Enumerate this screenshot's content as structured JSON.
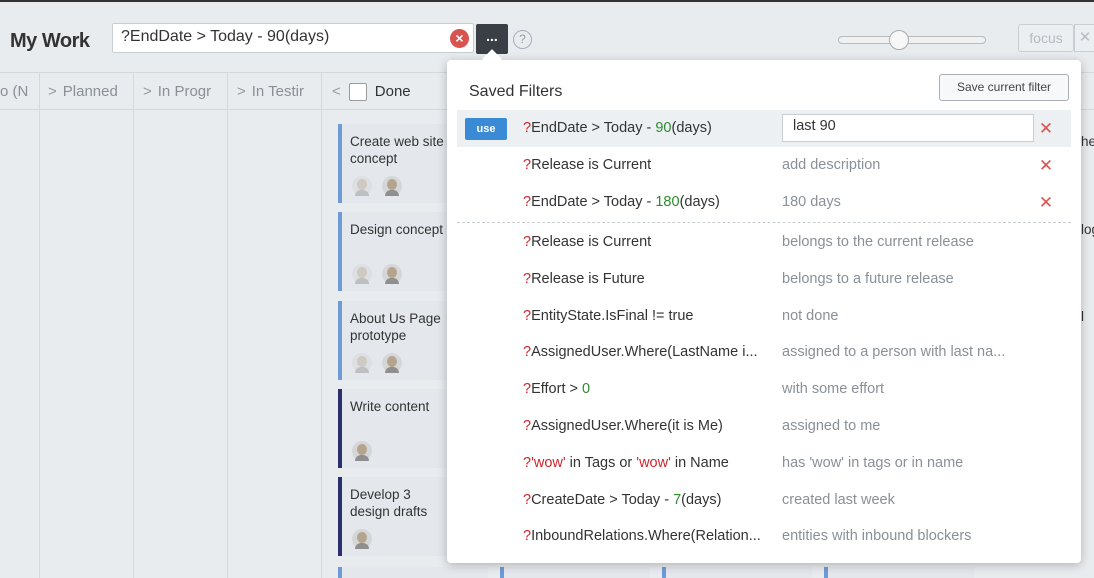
{
  "header": {
    "title": "My Work",
    "filter_value": "?EndDate > Today - 90(days)",
    "menu_label": "...",
    "help_label": "?",
    "focus_label": "focus",
    "close_label": "✕",
    "slider_level": 0.4
  },
  "columns": [
    {
      "label": "o (N",
      "chevron": ""
    },
    {
      "label": "Planned",
      "chevron": ">"
    },
    {
      "label": "In Progr",
      "chevron": ">"
    },
    {
      "label": "In Testir",
      "chevron": ">"
    },
    {
      "label": "Done",
      "chevron": "<"
    }
  ],
  "cards": [
    {
      "title": "Create web site concept",
      "avatars": 2
    },
    {
      "title": "Design concept",
      "avatars": 2
    },
    {
      "title": "About Us Page prototype",
      "avatars": 2
    },
    {
      "title": "Write content",
      "avatars": 1
    },
    {
      "title": "Develop 3 design drafts",
      "avatars": 1
    }
  ],
  "right_fragments": [
    "he",
    "log",
    "l"
  ],
  "saved_filters": {
    "title": "Saved Filters",
    "save_button": "Save current filter",
    "use_label": "use",
    "custom": [
      {
        "parts": [
          [
            "q",
            "?"
          ],
          [
            "t",
            "EndDate > Today - "
          ],
          [
            "n",
            "90"
          ],
          [
            "t",
            "(days)"
          ]
        ],
        "description": "last 90",
        "editing": true,
        "active": true
      },
      {
        "parts": [
          [
            "q",
            "?"
          ],
          [
            "t",
            "Release is Current"
          ]
        ],
        "description": "add description",
        "editing": false,
        "active": false
      },
      {
        "parts": [
          [
            "q",
            "?"
          ],
          [
            "t",
            "EndDate > Today - "
          ],
          [
            "n",
            "180"
          ],
          [
            "t",
            "(days)"
          ]
        ],
        "description": "180 days",
        "editing": false,
        "active": false
      }
    ],
    "predefined": [
      {
        "parts": [
          [
            "q",
            "?"
          ],
          [
            "t",
            "Release is Current"
          ]
        ],
        "description": "belongs to the current release"
      },
      {
        "parts": [
          [
            "q",
            "?"
          ],
          [
            "t",
            "Release is Future"
          ]
        ],
        "description": "belongs to a future release"
      },
      {
        "parts": [
          [
            "q",
            "?"
          ],
          [
            "t",
            "EntityState.IsFinal != true"
          ]
        ],
        "description": "not done"
      },
      {
        "parts": [
          [
            "q",
            "?"
          ],
          [
            "t",
            "AssignedUser.Where(LastName i..."
          ]
        ],
        "description": "assigned to a person with last na..."
      },
      {
        "parts": [
          [
            "q",
            "?"
          ],
          [
            "t",
            "Effort > "
          ],
          [
            "n",
            "0"
          ]
        ],
        "description": "with some effort"
      },
      {
        "parts": [
          [
            "q",
            "?"
          ],
          [
            "t",
            "AssignedUser.Where(it is Me)"
          ]
        ],
        "description": "assigned to me"
      },
      {
        "parts": [
          [
            "q",
            "?"
          ],
          [
            "s",
            "'wow'"
          ],
          [
            "t",
            " in Tags or "
          ],
          [
            "s",
            "'wow'"
          ],
          [
            "t",
            " in Name"
          ]
        ],
        "description": "has 'wow' in tags or in name"
      },
      {
        "parts": [
          [
            "q",
            "?"
          ],
          [
            "t",
            "CreateDate > Today - "
          ],
          [
            "n",
            "7"
          ],
          [
            "t",
            "(days)"
          ]
        ],
        "description": "created last week"
      },
      {
        "parts": [
          [
            "q",
            "?"
          ],
          [
            "t",
            "InboundRelations.Where(Relation..."
          ]
        ],
        "description": "entities with inbound blockers"
      }
    ]
  },
  "colors": {
    "accent": "#3a8ad6",
    "delete": "#d9534f",
    "keyword": "#d0242b",
    "number": "#2e8b2e",
    "card_border": "#6e9bd6",
    "card_border_dark": "#2b2f6b"
  }
}
